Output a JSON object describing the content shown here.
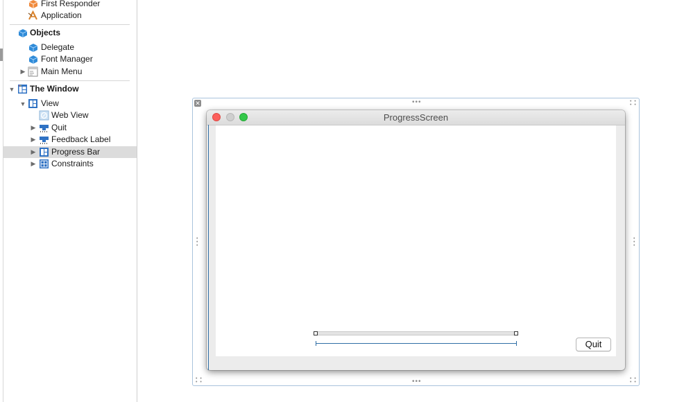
{
  "outline": {
    "items": [
      {
        "label": "First Responder",
        "icon": "first-responder-cube-icon"
      },
      {
        "label": "Application",
        "icon": "application-icon"
      },
      {
        "label": "Objects",
        "icon": "objects-cube-icon"
      },
      {
        "label": "Delegate",
        "icon": "object-cube-icon"
      },
      {
        "label": "Font Manager",
        "icon": "object-cube-icon"
      },
      {
        "label": "Main Menu",
        "icon": "menu-icon"
      },
      {
        "label": "The Window",
        "icon": "window-icon"
      },
      {
        "label": "View",
        "icon": "view-icon"
      },
      {
        "label": "Web View",
        "icon": "web-view-icon"
      },
      {
        "label": "Quit",
        "icon": "button-icon"
      },
      {
        "label": "Feedback Label",
        "icon": "label-icon"
      },
      {
        "label": "Progress Bar",
        "icon": "view-icon"
      },
      {
        "label": "Constraints",
        "icon": "constraints-icon"
      }
    ],
    "selected": "Progress Bar"
  },
  "canvas": {
    "window_title": "ProgressScreen",
    "quit_button_label": "Quit"
  },
  "colors": {
    "accent_blue": "#2f6ea5",
    "selection_gray": "#dcdcdc",
    "close_red": "#fc605c",
    "zoom_green": "#34c84a"
  }
}
